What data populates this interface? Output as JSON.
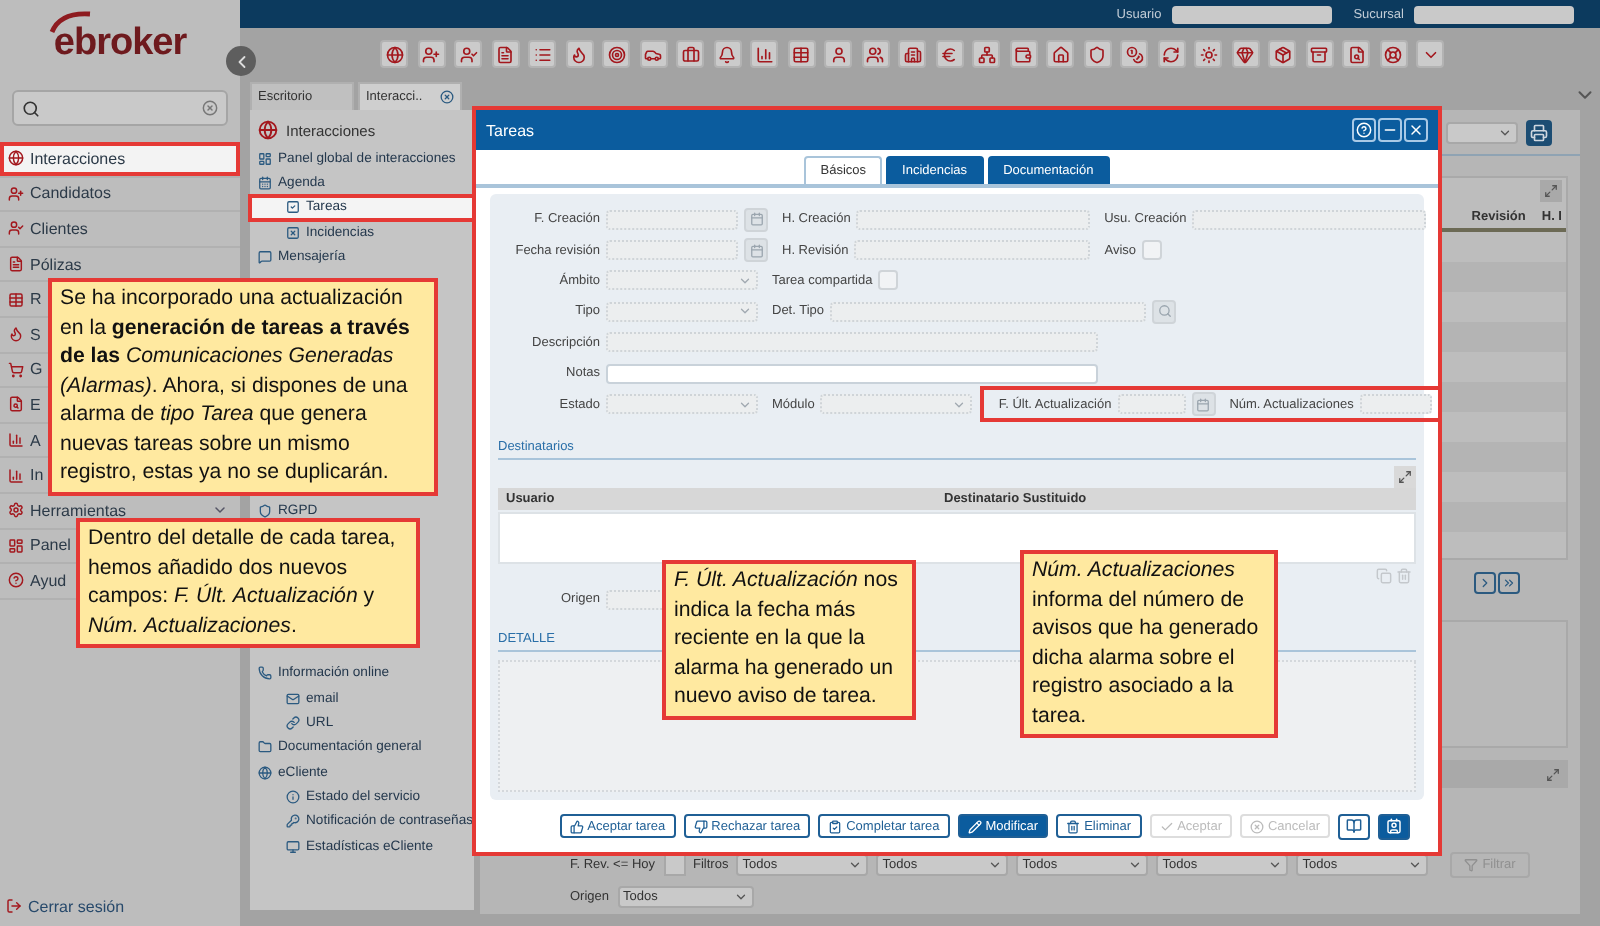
{
  "header": {
    "user_label": "Usuario",
    "branch_label": "Sucursal"
  },
  "logo": "ebroker",
  "sidebar": {
    "items": [
      {
        "label": "Interacciones",
        "selected": true,
        "highlighted": true,
        "kind": "link"
      },
      {
        "label": "Candidatos",
        "selected": false,
        "highlighted": false,
        "kind": "link"
      },
      {
        "label": "Clientes",
        "selected": false,
        "highlighted": false,
        "kind": "link"
      },
      {
        "label": "Pólizas",
        "selected": false,
        "highlighted": false,
        "kind": "link"
      },
      {
        "label": "R",
        "selected": false,
        "highlighted": false,
        "kind": "link"
      },
      {
        "label": "S",
        "selected": false,
        "highlighted": false,
        "kind": "link"
      },
      {
        "label": "G",
        "selected": false,
        "highlighted": false,
        "kind": "link"
      },
      {
        "label": "E",
        "selected": false,
        "highlighted": false,
        "kind": "link"
      },
      {
        "label": "A",
        "selected": false,
        "highlighted": false,
        "kind": "link"
      },
      {
        "label": "In",
        "selected": false,
        "highlighted": false,
        "kind": "link"
      },
      {
        "label": "Herramientas",
        "selected": false,
        "highlighted": false,
        "kind": "group"
      },
      {
        "label": "Panel",
        "selected": false,
        "highlighted": false,
        "kind": "link"
      },
      {
        "label": "Ayud",
        "selected": false,
        "highlighted": false,
        "kind": "link"
      }
    ],
    "logout": "Cerrar sesión"
  },
  "workspace_tabs": [
    {
      "label": "Escritorio",
      "selected": false,
      "closable": false
    },
    {
      "label": "Interacci..",
      "selected": true,
      "closable": true
    }
  ],
  "tree": {
    "title": "Interacciones",
    "parts": [
      [
        {
          "label": "Panel global de interacciones",
          "selected": false,
          "highlighted": false
        },
        {
          "label": "Agenda",
          "selected": false,
          "highlighted": false,
          "children": [
            {
              "label": "Tareas",
              "selected": true,
              "highlighted": true
            },
            {
              "label": "Incidencias",
              "selected": false,
              "highlighted": false
            }
          ]
        },
        {
          "label": "Mensajería",
          "selected": false,
          "highlighted": false
        }
      ],
      [
        {
          "label": "RGPD",
          "selected": false,
          "highlighted": false
        }
      ],
      [
        {
          "label": "Información online",
          "selected": false,
          "highlighted": false,
          "children": [
            {
              "label": "email",
              "selected": false,
              "highlighted": false
            },
            {
              "label": "URL",
              "selected": false,
              "highlighted": false
            }
          ]
        },
        {
          "label": "Documentación general",
          "selected": false,
          "highlighted": false
        },
        {
          "label": "eCliente",
          "selected": false,
          "highlighted": false,
          "children": [
            {
              "label": "Estado del servicio",
              "selected": false,
              "highlighted": false
            },
            {
              "label": "Notificación de contraseñas",
              "selected": false,
              "highlighted": false
            },
            {
              "label": "Estadísticas eCliente",
              "selected": false,
              "highlighted": false
            }
          ]
        }
      ]
    ]
  },
  "dialog": {
    "title": "Tareas",
    "tabs": [
      {
        "label": "Básicos",
        "selected": true
      },
      {
        "label": "Incidencias",
        "selected": false
      },
      {
        "label": "Documentación",
        "selected": false
      }
    ],
    "form_rows": [
      [
        {
          "label": "F. Creación",
          "kind": "date",
          "editable": false,
          "highlighted": false
        },
        {
          "label": "H. Creación",
          "kind": "text",
          "editable": false,
          "highlighted": false
        },
        {
          "label": "Usu. Creación",
          "kind": "text",
          "editable": false,
          "highlighted": false
        }
      ],
      [
        {
          "label": "Fecha revisión",
          "kind": "date",
          "editable": false,
          "highlighted": false
        },
        {
          "label": "H. Revisión",
          "kind": "text",
          "editable": false,
          "highlighted": false
        },
        {
          "label": "Aviso",
          "kind": "checkbox",
          "editable": false,
          "highlighted": false
        }
      ],
      [
        {
          "label": "Ámbito",
          "kind": "select",
          "editable": false,
          "highlighted": false
        },
        {
          "label": "Tarea compartida",
          "kind": "checkbox",
          "editable": false,
          "highlighted": false
        }
      ],
      [
        {
          "label": "Tipo",
          "kind": "select",
          "editable": false,
          "highlighted": false
        },
        {
          "label": "Det. Tipo",
          "kind": "lookup",
          "editable": false,
          "highlighted": false
        }
      ],
      [
        {
          "label": "Descripción",
          "kind": "long",
          "editable": false,
          "highlighted": false
        }
      ],
      [
        {
          "label": "Notas",
          "kind": "long",
          "editable": true,
          "highlighted": false
        }
      ],
      [
        {
          "label": "Estado",
          "kind": "select",
          "editable": false,
          "highlighted": false
        },
        {
          "label": "Módulo",
          "kind": "select",
          "editable": false,
          "highlighted": false
        },
        {
          "label": "F. Últ. Actualización",
          "kind": "short-date",
          "editable": false,
          "highlighted": true
        },
        {
          "label": "Núm. Actualizaciones",
          "kind": "number",
          "editable": false,
          "highlighted": true
        }
      ]
    ],
    "recipients": {
      "title": "Destinatarios",
      "columns": [
        "Usuario",
        "Destinatario Sustituido"
      ]
    },
    "origin_label": "Origen",
    "detail_title": "DETALLE",
    "buttons": [
      {
        "label": "Aceptar tarea",
        "kind": "accept-task",
        "disabled": false
      },
      {
        "label": "Rechazar tarea",
        "kind": "reject-task",
        "disabled": false
      },
      {
        "label": "Completar tarea",
        "kind": "complete-task",
        "disabled": false
      },
      {
        "label": "Modificar",
        "kind": "edit",
        "disabled": false
      },
      {
        "label": "Eliminar",
        "kind": "delete",
        "disabled": false
      },
      {
        "label": "Aceptar",
        "kind": "confirm",
        "disabled": true
      },
      {
        "label": "Cancelar",
        "kind": "cancel",
        "disabled": true
      }
    ]
  },
  "background": {
    "grid_columns": [
      "Revisión",
      "H. I"
    ],
    "rev_filter_label": "F. Rev. <= Hoy",
    "rev_filter_checked": false,
    "filters_label": "Filtros",
    "filter_values": [
      "Todos",
      "Todos",
      "Todos",
      "Todos",
      "Todos"
    ],
    "filter_button": "Filtrar",
    "origin_label": "Origen",
    "origin_value": "Todos"
  },
  "callouts": [
    {
      "text": "Se ha incorporado una actualización en la **generación de tareas a través de las** *Comunicaciones Generadas (Alarmas)*. Ahora, si dispones de una alarma de *tipo Tarea* que genera nuevas tareas sobre un mismo registro, estas ya no se duplicarán."
    },
    {
      "text": "Dentro del detalle de cada tarea, hemos añadido dos nuevos campos: *F. Últ. Actualización* y *Núm. Actualizaciones*."
    },
    {
      "text": "*F. Últ. Actualización* nos indica la fecha más reciente en la que la alarma ha generado un nuevo aviso de tarea."
    },
    {
      "text": "*Núm. Actualizaciones* informa del número de avisos que ha generado dicha alarma sobre el registro asociado a la tarea."
    }
  ]
}
